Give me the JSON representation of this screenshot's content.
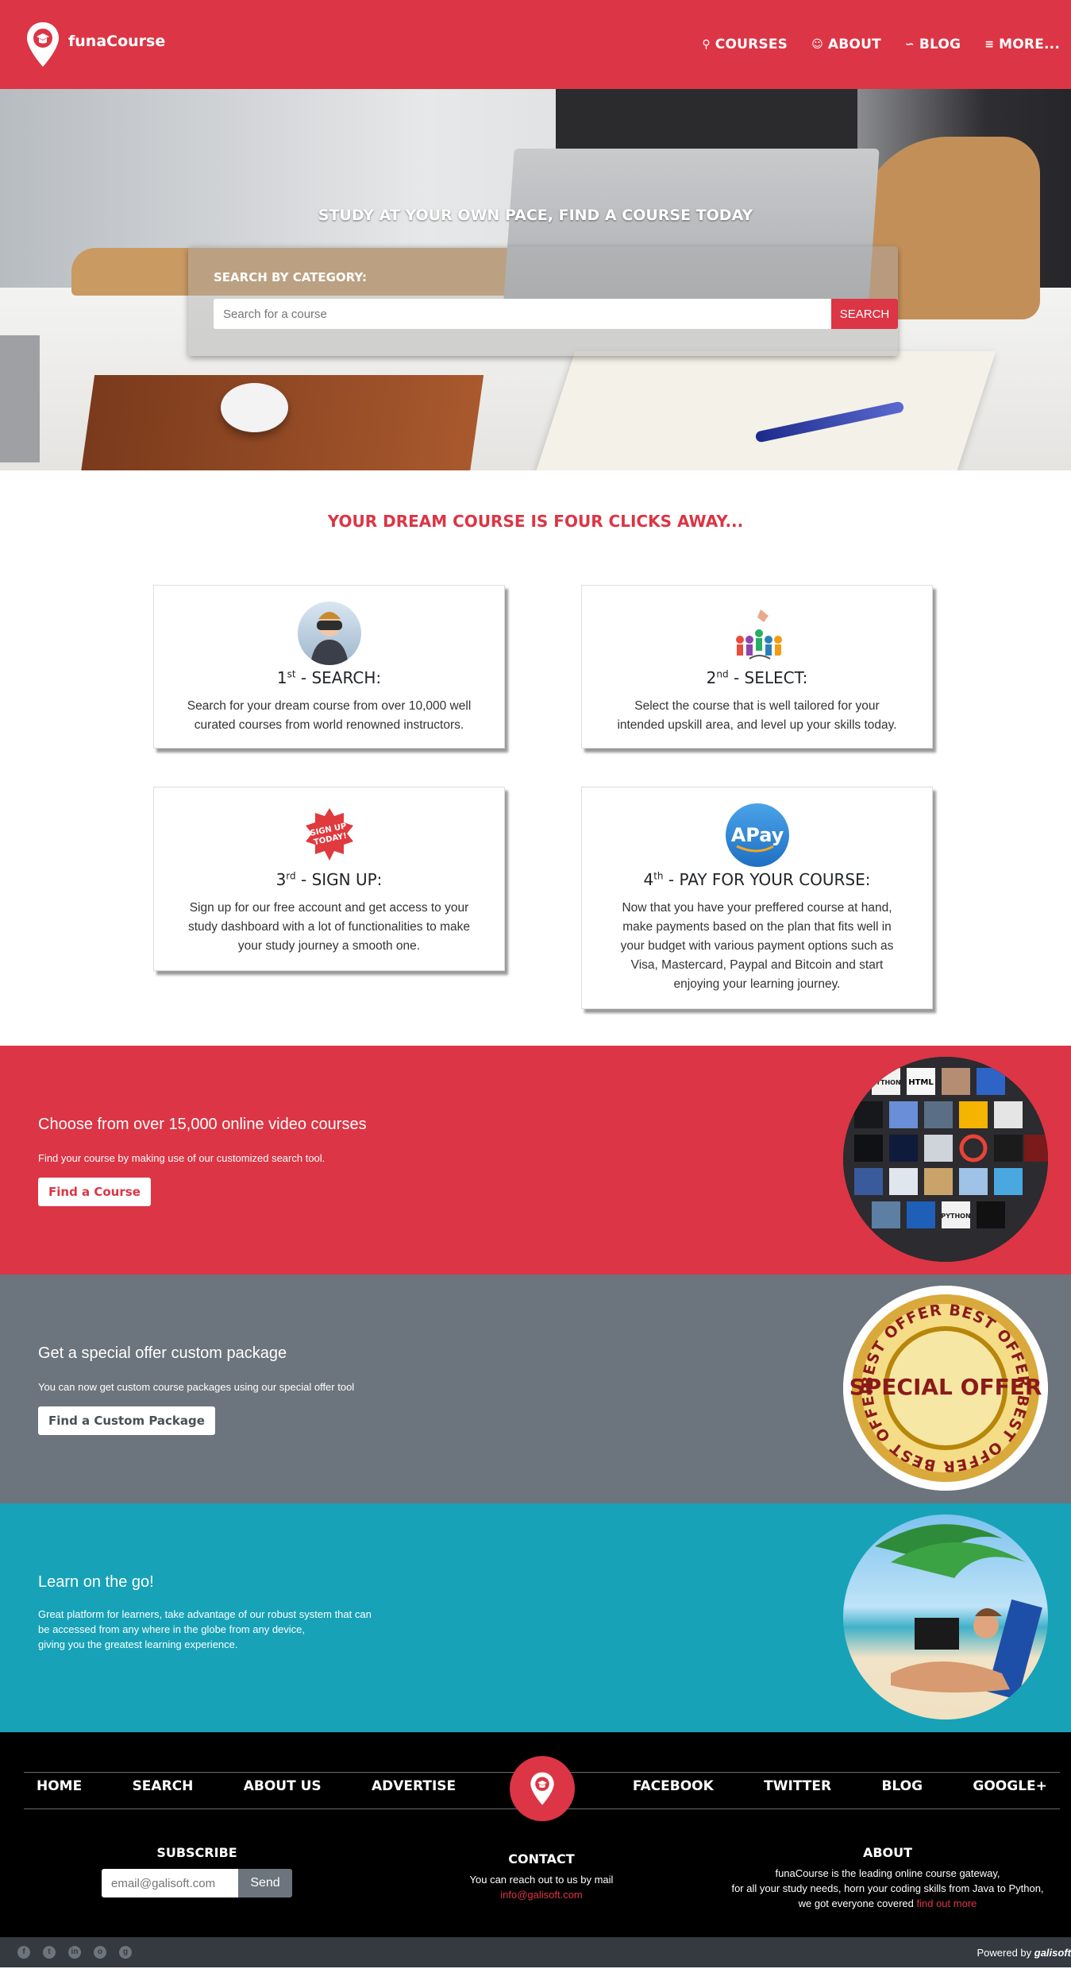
{
  "brand": {
    "name": "funaCourse"
  },
  "nav": {
    "items": [
      {
        "label": "COURSES",
        "icon": "search-icon"
      },
      {
        "label": "ABOUT",
        "icon": "user-icon"
      },
      {
        "label": "BLOG",
        "icon": "rss-icon"
      },
      {
        "label": "MORE...",
        "icon": "menu-icon"
      }
    ]
  },
  "hero": {
    "title": "STUDY AT YOUR OWN PACE, FIND A COURSE TODAY",
    "search_label": "SEARCH BY CATEGORY:",
    "search_placeholder": "Search for a course",
    "search_button": "SEARCH"
  },
  "steps": {
    "title": "YOUR DREAM COURSE IS FOUR CLICKS AWAY...",
    "items": [
      {
        "num": "1",
        "sup": "st",
        "title": " - SEARCH:",
        "text": "Search for your dream course from over 10,000 well curated courses from world renowned instructors.",
        "icon": "binoculars-icon"
      },
      {
        "num": "2",
        "sup": "nd",
        "title": " - SELECT:",
        "text": "Select the course that is well tailored for your intended upskill area, and level up your skills today.",
        "icon": "select-people-icon"
      },
      {
        "num": "3",
        "sup": "rd",
        "title": " - SIGN UP:",
        "text": "Sign up for our free account and get access to your study dashboard with a lot of functionalities to make your study journey a smooth one.",
        "icon": "sign-up-badge-icon",
        "badge_text": "SIGN UP TODAY!"
      },
      {
        "num": "4",
        "sup": "th",
        "title": " - PAY FOR YOUR COURSE:",
        "text": "Now that you have your preffered course at hand, make payments based on the plan that fits well in your budget with various payment options such as Visa, Mastercard, Paypal and Bitcoin and start enjoying your learning journey.",
        "icon": "apay-icon",
        "badge_text": "APay"
      }
    ]
  },
  "bands": [
    {
      "heading": "Choose from over 15,000 online video courses",
      "text": "Find your course by making use of our customized search tool.",
      "button": "Find a Course",
      "color": "#dc3545"
    },
    {
      "heading": "Get a special offer custom package",
      "text": "You can now get custom course packages using our special offer tool",
      "button": "Find a Custom Package",
      "color": "#6c757d",
      "badge_center": "SPECIAL OFFER",
      "badge_ring": "BEST OFFER BEST OFFER BEST OFFER BEST OFFER BEST"
    },
    {
      "heading": "Learn on the go!",
      "text_lines": [
        "Great platform for learners, take advantage of our robust system that can",
        "be accessed from any where in the globe from any device,",
        "giving you the greatest learning experience."
      ],
      "color": "#17a2b8"
    }
  ],
  "course_thumbs": [
    "PYTHON",
    "HTML",
    "PYTHON"
  ],
  "footer": {
    "nav": [
      "HOME",
      "SEARCH",
      "ABOUT US",
      "ADVERTISE",
      "FACEBOOK",
      "TWITTER",
      "BLOG",
      "GOOGLE+"
    ],
    "subscribe": {
      "title": "SUBSCRIBE",
      "placeholder": "email@galisoft.com",
      "button": "Send"
    },
    "contact": {
      "title": "CONTACT",
      "text": "You can reach out to us by mail",
      "email": "info@galisoft.com"
    },
    "about": {
      "title": "ABOUT",
      "lines": [
        "funaCourse is the leading online course gateway,",
        "for all your study needs, horn your coding skills from Java to Python,",
        "we got everyone covered"
      ],
      "link": "find out more"
    },
    "social": [
      "facebook-icon",
      "twitter-icon",
      "linkedin-icon",
      "instagram-icon",
      "github-icon"
    ],
    "powered_prefix": "Powered by",
    "powered_brand": "galisoft"
  },
  "colors": {
    "primary": "#dc3545",
    "secondary": "#6c757d",
    "info": "#17a2b8",
    "dark": "#343a40"
  }
}
